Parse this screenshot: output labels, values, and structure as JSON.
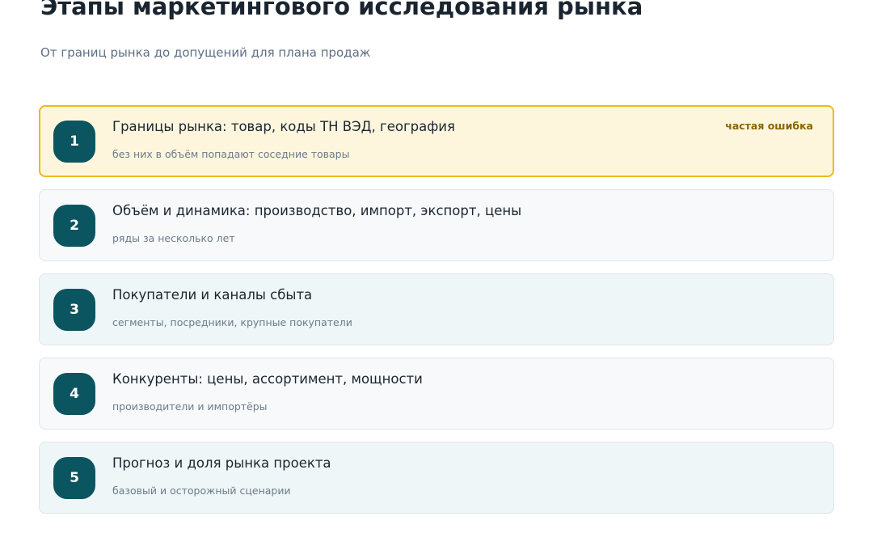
{
  "title": "Этапы маркетингового исследования рынка",
  "subtitle": "От границ рынка до допущений для плана продаж",
  "steps": [
    {
      "number": "1",
      "title": "Границы рынка: товар, коды ТН ВЭД, география",
      "description": "без них в объём попадают соседние товары",
      "badge": "частая ошибка",
      "highlighted": true
    },
    {
      "number": "2",
      "title": "Объём и динамика: производство, импорт, экспорт, цены",
      "description": "ряды за несколько лет"
    },
    {
      "number": "3",
      "title": "Покупатели и каналы сбыта",
      "description": "сегменты, посредники, крупные покупатели"
    },
    {
      "number": "4",
      "title": "Конкуренты: цены, ассортимент, мощности",
      "description": "производители и импортёры"
    },
    {
      "number": "5",
      "title": "Прогноз и доля рынка проекта",
      "description": "базовый и осторожный сценарии"
    }
  ],
  "colors": {
    "badge_number_bg": "#0b5561",
    "highlight_bg": "#fdf6dd",
    "highlight_border": "#efb81f",
    "badge_text": "#8a6404",
    "card_bg": "#f7f9fb",
    "card_tint_bg": "#eef6f7"
  }
}
